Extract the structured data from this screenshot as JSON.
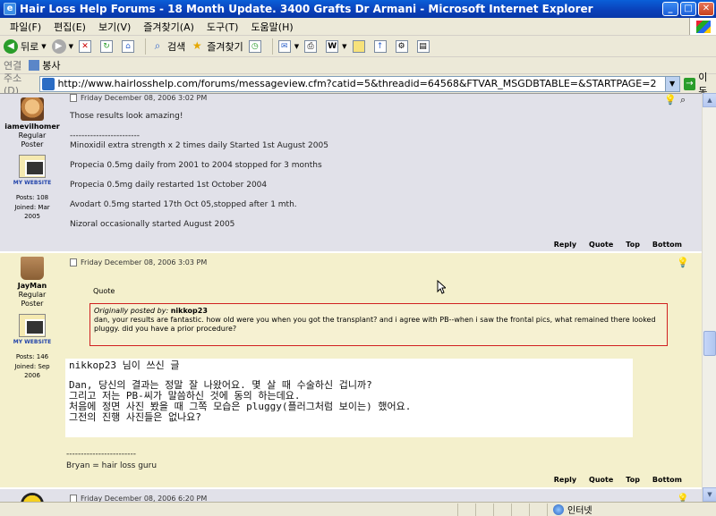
{
  "window": {
    "title": "Hair Loss Help Forums - 18 Month Update. 3400 Grafts Dr Armani - Microsoft Internet Explorer"
  },
  "menu": [
    "파일(F)",
    "편집(E)",
    "보기(V)",
    "즐겨찾기(A)",
    "도구(T)",
    "도움말(H)"
  ],
  "toolbar": {
    "back": "뒤로",
    "search": "검색",
    "favorites": "즐겨찾기"
  },
  "links": {
    "label": "연결",
    "item": "봉사"
  },
  "address": {
    "label": "주소(D)",
    "url": "http://www.hairlosshelp.com/forums/messageview.cfm?catid=5&threadid=64568&FTVAR_MSGDBTABLE=&STARTPAGE=2",
    "go": "이동"
  },
  "posts": [
    {
      "user": {
        "name": "iamevilhomer",
        "rank_1": "Regular",
        "rank_2": "Poster",
        "website": "MY WEBSITE",
        "posts": "Posts: 108",
        "joined_1": "Joined: Mar",
        "joined_2": "2005"
      },
      "date": "Friday December 08, 2006 3:02 PM",
      "lines": [
        "Those results look amazing!",
        "------------------------",
        "Minoxidil extra strength x 2 times daily Started 1st August 2005",
        "Propecia 0.5mg daily from 2001 to 2004 stopped for 3 months",
        "Propecia 0.5mg daily restarted 1st October 2004",
        "Avodart 0.5mg started 17th Oct 05,stopped after 1 mth.",
        "Nizoral occasionally started August 2005"
      ]
    },
    {
      "user": {
        "name": "JayMan",
        "rank_1": "Regular",
        "rank_2": "Poster",
        "website": "MY WEBSITE",
        "posts": "Posts: 146",
        "joined_1": "Joined: Sep",
        "joined_2": "2006"
      },
      "date": "Friday December 08, 2006 3:03 PM",
      "quote_label": "Quote",
      "quote_author_prefix": "Originally posted by:",
      "quote_author": "nikkop23",
      "quote_text": "dan, your results are fantastic. how old were you when you got the transplant? and i agree with PB--when i saw the frontal pics, what remained there looked pluggy. did you have a prior procedure?",
      "translation": {
        "title": "nikkop23 님이 쓰신 글",
        "lines": [
          "Dan, 당신의 결과는 정말 잘 나왔어요. 몇 살 때 수술하신 겁니까?",
          "그리고 저는 PB-씨가 말씀하신 것에 동의 하는데요.",
          "처음에 정면 사진 봤을 때 그쪽 모습은 pluggy(플러그처럼 보이는) 했어요.",
          "그전의 진행 사진들은 없나요?"
        ]
      },
      "sig_sep": "------------------------",
      "sig": "Bryan = hair loss guru"
    },
    {
      "date": "Friday December 08, 2006 6:20 PM"
    }
  ],
  "actions": {
    "reply": "Reply",
    "quote": "Quote",
    "top": "Top",
    "bottom": "Bottom"
  },
  "status": {
    "zone": "인터넷"
  }
}
